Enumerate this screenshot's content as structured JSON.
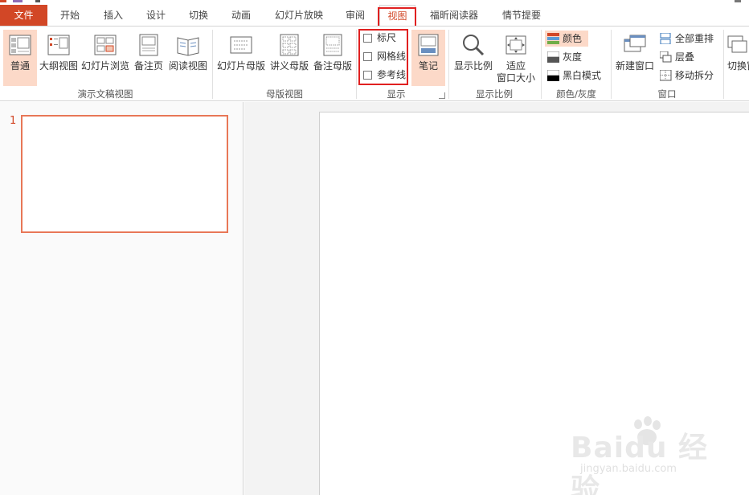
{
  "tabs": [
    {
      "id": "file",
      "label": "文件"
    },
    {
      "id": "home",
      "label": "开始"
    },
    {
      "id": "insert",
      "label": "插入"
    },
    {
      "id": "design",
      "label": "设计"
    },
    {
      "id": "transitions",
      "label": "切换"
    },
    {
      "id": "animations",
      "label": "动画"
    },
    {
      "id": "slideshow",
      "label": "幻灯片放映"
    },
    {
      "id": "review",
      "label": "审阅"
    },
    {
      "id": "view",
      "label": "视图"
    },
    {
      "id": "foxit",
      "label": "福昕阅读器"
    },
    {
      "id": "storyline",
      "label": "情节提要"
    }
  ],
  "active_tab": "视图",
  "ribbon": {
    "presentation_views": {
      "group_label": "演示文稿视图",
      "buttons": [
        "普通",
        "大纲视图",
        "幻灯片浏览",
        "备注页",
        "阅读视图"
      ],
      "selected": "普通"
    },
    "master_views": {
      "group_label": "母版视图",
      "buttons": [
        "幻灯片母版",
        "讲义母版",
        "备注母版"
      ]
    },
    "show": {
      "group_label": "显示",
      "checkboxes": [
        {
          "label": "标尺",
          "checked": false
        },
        {
          "label": "网格线",
          "checked": false
        },
        {
          "label": "参考线",
          "checked": false
        }
      ],
      "notes_button": "笔记"
    },
    "zoom": {
      "group_label": "显示比例",
      "zoom_button": "显示比例",
      "fit_button_line1": "适应",
      "fit_button_line2": "窗口大小"
    },
    "color": {
      "group_label": "颜色/灰度",
      "items": [
        "颜色",
        "灰度",
        "黑白模式"
      ],
      "selected": "颜色"
    },
    "window": {
      "group_label": "窗口",
      "new_window": "新建窗口",
      "items": [
        "全部重排",
        "层叠",
        "移动拆分"
      ],
      "switch_window": "切换窗"
    }
  },
  "slides": [
    {
      "number": "1"
    }
  ],
  "watermark": {
    "main": "Baidu 经验",
    "sub": "jingyan.baidu.com"
  },
  "colors": {
    "accent": "#d24726",
    "highlight": "#e02020",
    "selected_bg": "#fcd9c8",
    "thumb_border": "#e87757"
  }
}
